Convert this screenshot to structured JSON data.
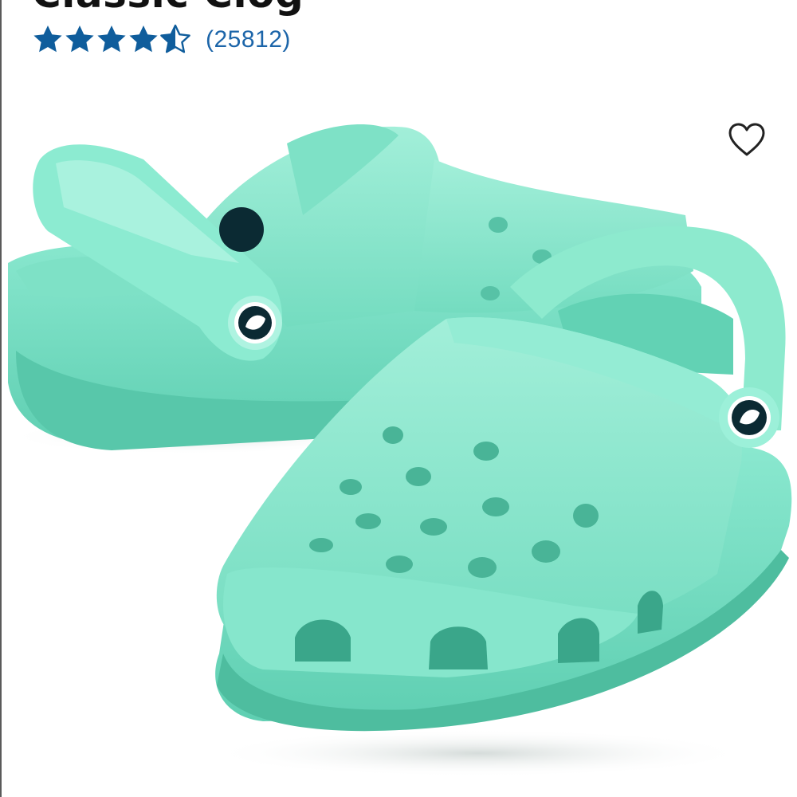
{
  "product": {
    "title": "Classic Clog",
    "rating": 4.5,
    "rating_max": 5,
    "review_count": "(25812)"
  },
  "colors": {
    "star": "#0f5d9c",
    "review_link": "#1c65a9",
    "clog_base": "#7fe3c8",
    "clog_light": "#a6f0dc",
    "clog_shadow": "#56c9ad",
    "title": "#111111"
  },
  "icons": {
    "rating": "star-icon",
    "wishlist": "heart-outline-icon",
    "logo": "crocs-jibbitz-logo-icon"
  }
}
